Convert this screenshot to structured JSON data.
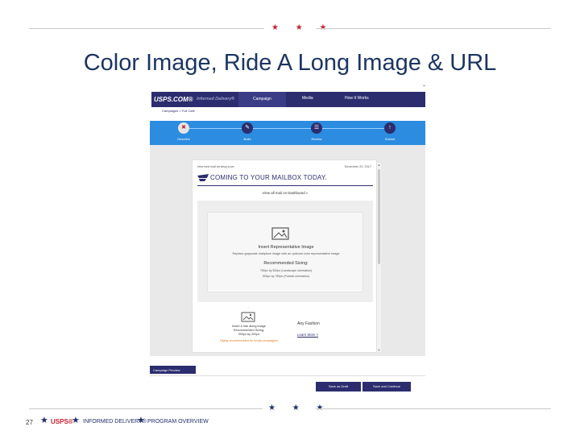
{
  "slide": {
    "title": "Color Image, Ride A Long Image & URL",
    "page_number": "27",
    "footer_brand": "USPS®",
    "footer_program": "INFORMED DELIVERY®",
    "footer_overview": "PROGRAM OVERVIEW",
    "stars": "★ ★ ★",
    "footer_star": "★"
  },
  "screenshot": {
    "header": {
      "brand": "USPS.COM®",
      "brand_sub": "Informed Delivery®",
      "nav": [
        "Campaign",
        "Media",
        "How It Works"
      ]
    },
    "breadcrumb": "Campaigns > Full Cafe",
    "steps": [
      {
        "icon": "✖",
        "label": "Describe"
      },
      {
        "icon": "✎",
        "label": "Build"
      },
      {
        "icon": "☰",
        "label": "Review"
      },
      {
        "icon": "↑",
        "label": "Submit"
      }
    ],
    "email": {
      "from": "Informed mail arriving soon",
      "date": "December 20, 2017",
      "headline": "COMING TO YOUR MAILBOX TODAY.",
      "view_link": "View all mail on Dashboard »",
      "hero": {
        "title": "Insert Representative Image",
        "description": "Replace grayscale mailpiece image with an optional color representative image",
        "size_title": "Recommended Sizing:",
        "size_line_1": "780px by 500px (Landscape orientation)",
        "size_line_2": "500px by 780px (Portrait orientation)"
      },
      "ride_along": {
        "line_1": "Insert a ride along image",
        "line_2": "Recommended Sizing:",
        "line_3": "300px by 200px",
        "line_4": "Highly recommended for email campaigns!"
      },
      "caption_title": "Any Fashion",
      "learn_more": "Learn More >"
    },
    "campaign_preview": "Campaign Preview",
    "buttons": {
      "save_draft": "Save as Draft",
      "save_continue": "Save and Continue"
    },
    "scroll": {
      "up": "▲",
      "down": "▼"
    }
  },
  "colors": {
    "title": "#1c3563",
    "usps_navy": "#2b2d6e",
    "stepper_blue": "#2b8ce0",
    "usps_red": "#c8202f",
    "note_orange": "#e07a1f"
  }
}
